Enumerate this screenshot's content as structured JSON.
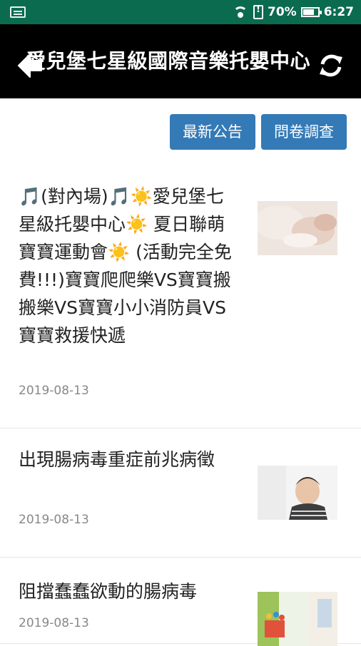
{
  "status_bar": {
    "battery": "70%",
    "time": "6:27"
  },
  "app_bar": {
    "title": "愛兒堡七星級國際音樂托嬰中心"
  },
  "buttons": {
    "news": "最新公告",
    "survey": "問卷調查"
  },
  "items": [
    {
      "title": "🎵(對內場)🎵☀️愛兒堡七星級托嬰中心☀️ 夏日聯萌寶寶運動會☀️ (活動完全免費!!!)寶寶爬爬樂VS寶寶搬搬樂VS寶寶小小消防員VS寶寶救援快遞",
      "date": "2019-08-13"
    },
    {
      "title": "出現腸病毒重症前兆病徵",
      "date": "2019-08-13"
    },
    {
      "title": "阻擋蠢蠢欲動的腸病毒",
      "date": "2019-08-13"
    }
  ],
  "colors": {
    "status_bar": "#0b6b4f",
    "app_bar": "#000000",
    "button": "#337ab7"
  }
}
